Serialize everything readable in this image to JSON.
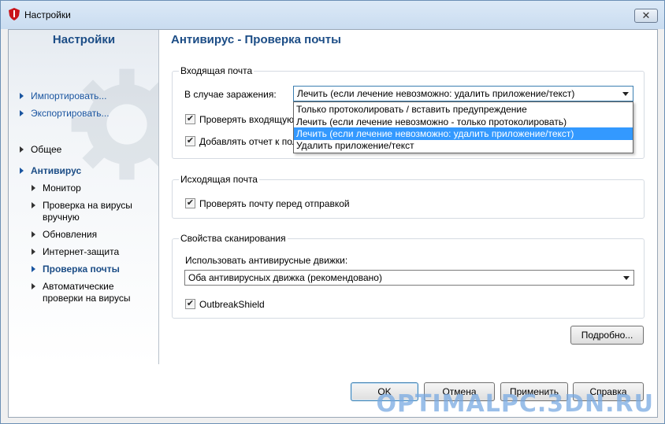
{
  "window": {
    "title": "Настройки",
    "close_glyph": "✕"
  },
  "sidebar": {
    "title": "Настройки",
    "links": [
      {
        "label": "Импортировать..."
      },
      {
        "label": "Экспортировать..."
      }
    ],
    "items": [
      {
        "label": "Общее"
      },
      {
        "label": "Антивирус"
      },
      {
        "label": "Монитор"
      },
      {
        "label": "Проверка на вирусы вручную"
      },
      {
        "label": "Обновления"
      },
      {
        "label": "Интернет-защита"
      },
      {
        "label": "Проверка почты"
      },
      {
        "label": "Автоматические проверки на вирусы"
      }
    ]
  },
  "main": {
    "title": "Антивирус - Проверка почты",
    "incoming": {
      "legend": "Входящая почта",
      "infection_label": "В случае заражения:",
      "infection_value": "Лечить (если лечение невозможно: удалить приложение/текст)",
      "options": [
        "Только протоколировать / вставить предупреждение",
        "Лечить (если лечение невозможно - только протоколировать)",
        "Лечить (если лечение невозможно: удалить приложение/текст)",
        "Удалить приложение/текст"
      ],
      "selected_index": 2,
      "check_incoming_label": "Проверять входящую",
      "add_report_label": "Добавлять отчет к пол"
    },
    "outgoing": {
      "legend": "Исходящая почта",
      "check_before_send_label": "Проверять почту перед отправкой"
    },
    "scan": {
      "legend": "Свойства сканирования",
      "engines_label": "Использовать антивирусные движки:",
      "engines_value": "Оба антивирусных движка (рекомендовано)",
      "outbreak_label": "OutbreakShield"
    },
    "details_button": "Подробно..."
  },
  "footer": {
    "ok": "OK",
    "cancel": "Отмена",
    "apply": "Применить",
    "help": "Справка"
  },
  "watermark": "OPTIMALPC.3DN.RU",
  "checked_glyph": "✔",
  "colors": {
    "accent": "#1c4d86",
    "selection": "#3399ff",
    "link": "#1a55a0"
  }
}
